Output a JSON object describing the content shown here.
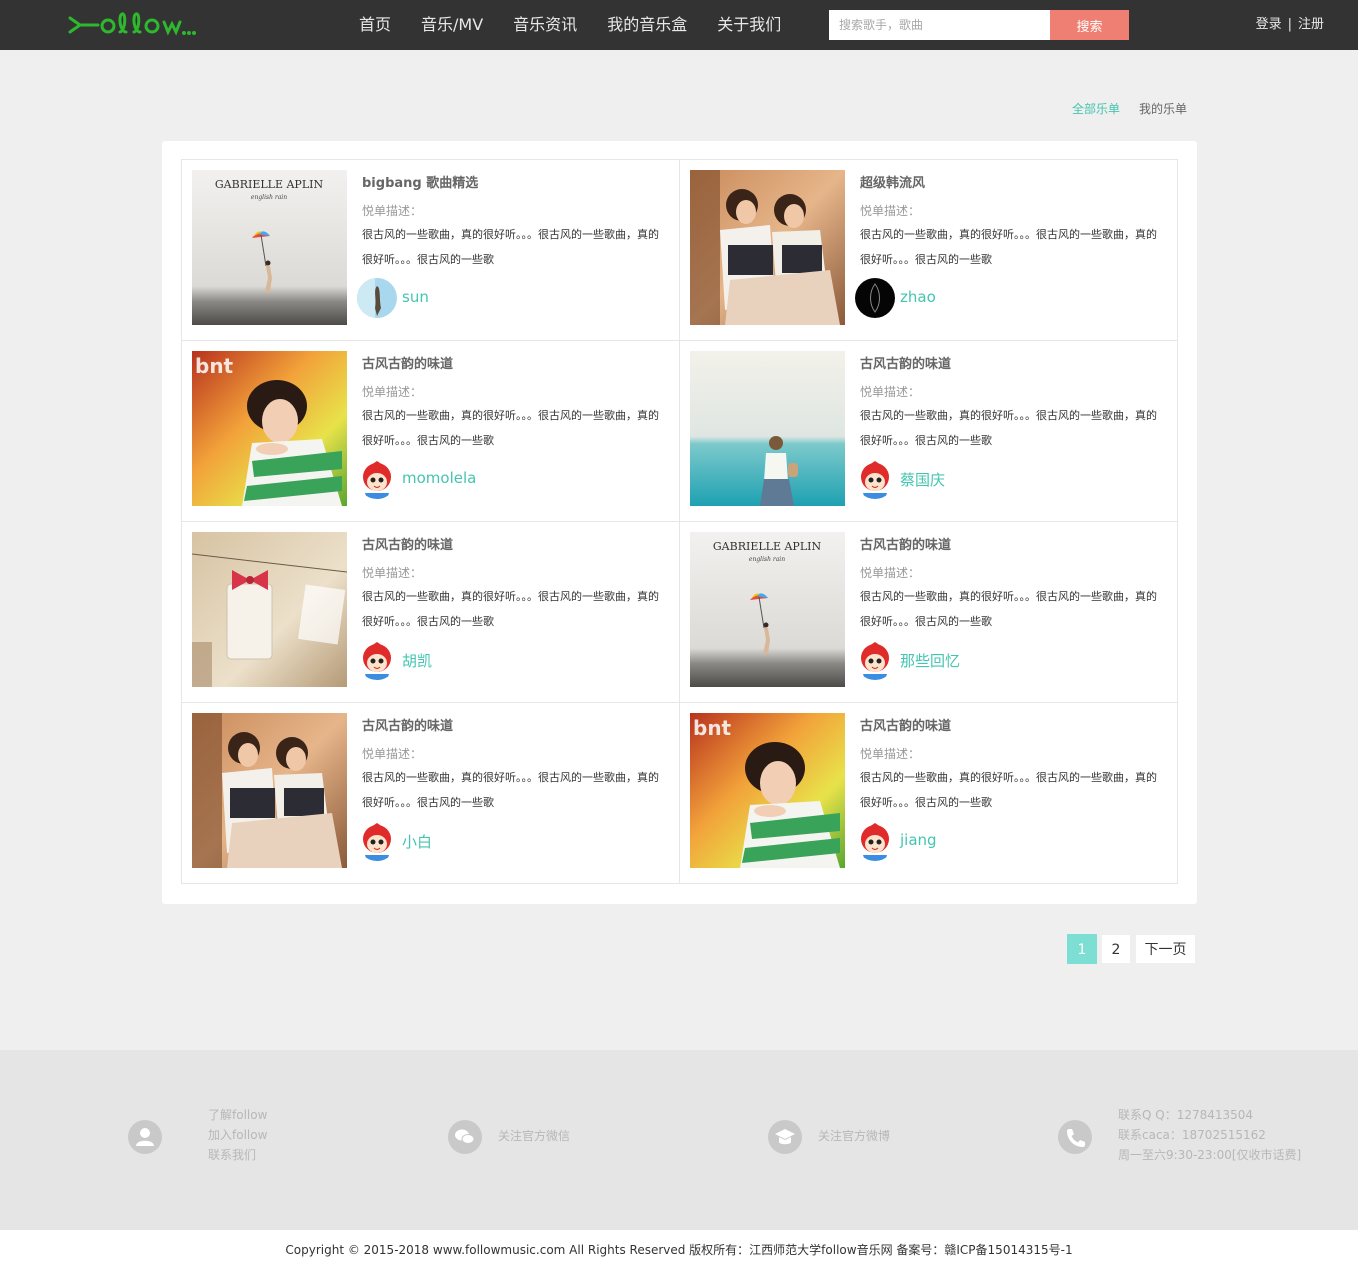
{
  "header": {
    "logo_text": "follow",
    "nav": [
      "首页",
      "音乐/MV",
      "音乐资讯",
      "我的音乐盒",
      "关于我们"
    ],
    "search_placeholder": "搜索歌手，歌曲",
    "search_button": "搜索",
    "login": "登录",
    "separator": "|",
    "register": "注册"
  },
  "tabs": {
    "all": "全部乐单",
    "mine": "我的乐单"
  },
  "playlists": [
    {
      "title": "bigbang 歌曲精选",
      "desc_label": "悦单描述：",
      "desc": "很古风的一些歌曲，真的很好听。。。很古风的一些歌曲，真的很好听。。。很古风的一些歌",
      "user": "sun",
      "cover": "gabrielle",
      "avatar": "photo-blue"
    },
    {
      "title": "超级韩流风",
      "desc_label": "悦单描述：",
      "desc": "很古风的一些歌曲，真的很好听。。。很古风的一些歌曲，真的很好听。。。很古风的一些歌",
      "user": "zhao",
      "cover": "girls",
      "avatar": "dark"
    },
    {
      "title": "古风古韵的味道",
      "desc_label": "悦单描述：",
      "desc": "很古风的一些歌曲，真的很好听。。。很古风的一些歌曲，真的很好听。。。很古风的一些歌",
      "user": "momolela",
      "cover": "bnt",
      "avatar": "cartoon"
    },
    {
      "title": "古风古韵的味道",
      "desc_label": "悦单描述：",
      "desc": "很古风的一些歌曲，真的很好听。。。很古风的一些歌曲，真的很好听。。。很古风的一些歌",
      "user": "蔡国庆",
      "cover": "sea",
      "avatar": "cartoon"
    },
    {
      "title": "古风古韵的味道",
      "desc_label": "悦单描述：",
      "desc": "很古风的一些歌曲，真的很好听。。。很古风的一些歌曲，真的很好听。。。很古风的一些歌",
      "user": "胡凯",
      "cover": "bow",
      "avatar": "cartoon"
    },
    {
      "title": "古风古韵的味道",
      "desc_label": "悦单描述：",
      "desc": "很古风的一些歌曲，真的很好听。。。很古风的一些歌曲，真的很好听。。。很古风的一些歌",
      "user": "那些回忆",
      "cover": "gabrielle",
      "avatar": "cartoon"
    },
    {
      "title": "古风古韵的味道",
      "desc_label": "悦单描述：",
      "desc": "很古风的一些歌曲，真的很好听。。。很古风的一些歌曲，真的很好听。。。很古风的一些歌",
      "user": "小白",
      "cover": "girls",
      "avatar": "cartoon"
    },
    {
      "title": "古风古韵的味道",
      "desc_label": "悦单描述：",
      "desc": "很古风的一些歌曲，真的很好听。。。很古风的一些歌曲，真的很好听。。。很古风的一些歌",
      "user": "jiang",
      "cover": "bnt",
      "avatar": "cartoon"
    }
  ],
  "cover_art_text": {
    "gabrielle_artist": "GABRIELLE APLIN",
    "gabrielle_album": "english rain",
    "bnt": "bnt"
  },
  "pagination": {
    "current": "1",
    "page2": "2",
    "next": "下一页"
  },
  "footer": {
    "about": [
      "了解follow",
      "加入follow",
      "联系我们"
    ],
    "wechat": "关注官方微信",
    "weibo": "关注官方微博",
    "contact": [
      "联系Q Q：1278413504",
      "联系caca：18702515162",
      "周一至六9:30-23:00[仅收市话费]"
    ],
    "icons": [
      "user-icon",
      "wechat-icon",
      "weibo-icon",
      "phone-icon"
    ]
  },
  "copyright": "Copyright © 2015-2018 www.followmusic.com All Rights Reserved 版权所有：江西师范大学follow音乐网 备案号：赣ICP备15014315号-1",
  "colors": {
    "accent": "#44c5b0",
    "search_button": "#ee7f72",
    "topbar": "#333333",
    "page_current": "#7ddfd3"
  }
}
